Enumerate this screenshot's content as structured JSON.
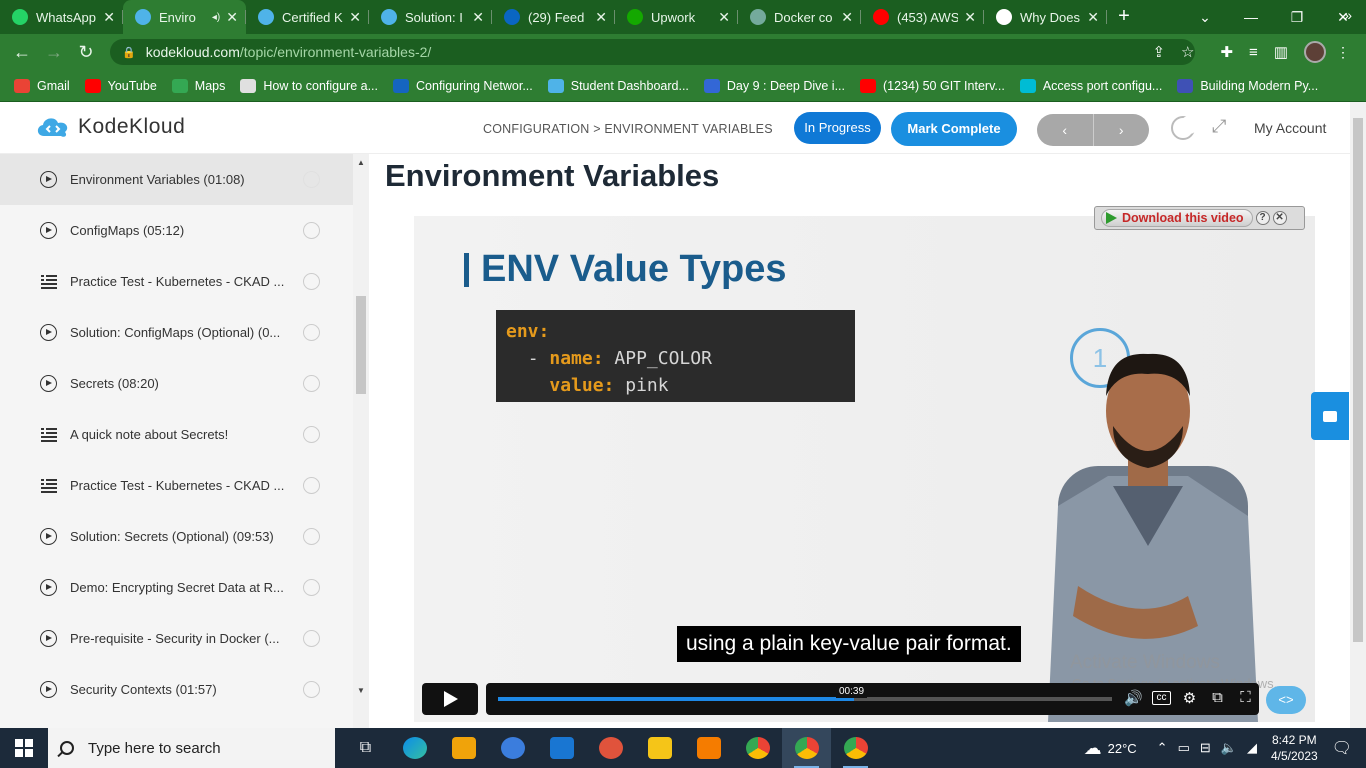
{
  "browser": {
    "tabs": [
      {
        "label": "WhatsApp",
        "icon": "whatsapp-icon",
        "color": "#25d366"
      },
      {
        "label": "Enviro",
        "icon": "kodekloud-icon",
        "color": "#4fb3e8",
        "active": true
      },
      {
        "label": "Certified K",
        "icon": "kodekloud-icon",
        "color": "#4fb3e8"
      },
      {
        "label": "Solution: I",
        "icon": "kodekloud-icon",
        "color": "#4fb3e8"
      },
      {
        "label": "(29) Feed |",
        "icon": "linkedin-icon",
        "color": "#0a66c2"
      },
      {
        "label": "Upwork",
        "icon": "upwork-icon",
        "color": "#14a800"
      },
      {
        "label": "Docker co",
        "icon": "openai-icon",
        "color": "#74aa9c"
      },
      {
        "label": "(453) AWS",
        "icon": "youtube-icon",
        "color": "#ff0000"
      },
      {
        "label": "Why Does",
        "icon": "map-pin-icon",
        "color": "#ffffff"
      }
    ],
    "address": {
      "domain": "kodekloud.com",
      "path": "/topic/environment-variables-2/"
    },
    "bookmarks": [
      {
        "label": "Gmail",
        "color": "#ea4335"
      },
      {
        "label": "YouTube",
        "color": "#ff0000"
      },
      {
        "label": "Maps",
        "color": "#34a853"
      },
      {
        "label": "How to configure a...",
        "color": "#e0e0e0"
      },
      {
        "label": "Configuring Networ...",
        "color": "#1565c0"
      },
      {
        "label": "Student Dashboard...",
        "color": "#4fb3e8"
      },
      {
        "label": "Day 9 : Deep Dive i...",
        "color": "#3367d6"
      },
      {
        "label": "(1234) 50 GIT Interv...",
        "color": "#ff0000"
      },
      {
        "label": "Access port configu...",
        "color": "#00bcd4"
      },
      {
        "label": "Building Modern Py...",
        "color": "#3f51b5"
      }
    ]
  },
  "header": {
    "logo_text": "KodeKloud",
    "breadcrumb": "CONFIGURATION > ENVIRONMENT VARIABLES",
    "status_button": "In Progress",
    "complete_button": "Mark Complete",
    "prev_label": "‹",
    "next_label": "›",
    "account": "My Account"
  },
  "sidebar": {
    "lessons": [
      {
        "title": "Environment Variables (01:08)",
        "type": "video",
        "current": true
      },
      {
        "title": "ConfigMaps (05:12)",
        "type": "video"
      },
      {
        "title": "Practice Test - Kubernetes - CKAD ...",
        "type": "lab"
      },
      {
        "title": "Solution: ConfigMaps (Optional) (0...",
        "type": "video"
      },
      {
        "title": "Secrets (08:20)",
        "type": "video"
      },
      {
        "title": "A quick note about Secrets!",
        "type": "lab"
      },
      {
        "title": "Practice Test - Kubernetes - CKAD ...",
        "type": "lab"
      },
      {
        "title": "Solution: Secrets (Optional) (09:53)",
        "type": "video"
      },
      {
        "title": "Demo: Encrypting Secret Data at R...",
        "type": "video"
      },
      {
        "title": "Pre-requisite - Security in Docker (...",
        "type": "video"
      },
      {
        "title": "Security Contexts (01:57)",
        "type": "video"
      }
    ]
  },
  "main": {
    "title": "Environment Variables",
    "download_label": "Download this video",
    "video": {
      "slide_title": "ENV Value Types",
      "code": {
        "l1_key": "env:",
        "l2_dash": "- ",
        "l2_key": "name:",
        "l2_val": " APP_COLOR",
        "l3_key": "value:",
        "l3_val": " pink"
      },
      "step_number": "1",
      "subtitle": "using a plain key-value pair format.",
      "current_time": "00:39",
      "progress": 0.58,
      "watermark_line1": "Activate Windows",
      "watermark_line2": "Go to Settings to activate Windows."
    }
  },
  "taskbar": {
    "search_placeholder": "Type here to search",
    "weather": "22°C",
    "time": "8:42 PM",
    "date": "4/5/2023"
  }
}
